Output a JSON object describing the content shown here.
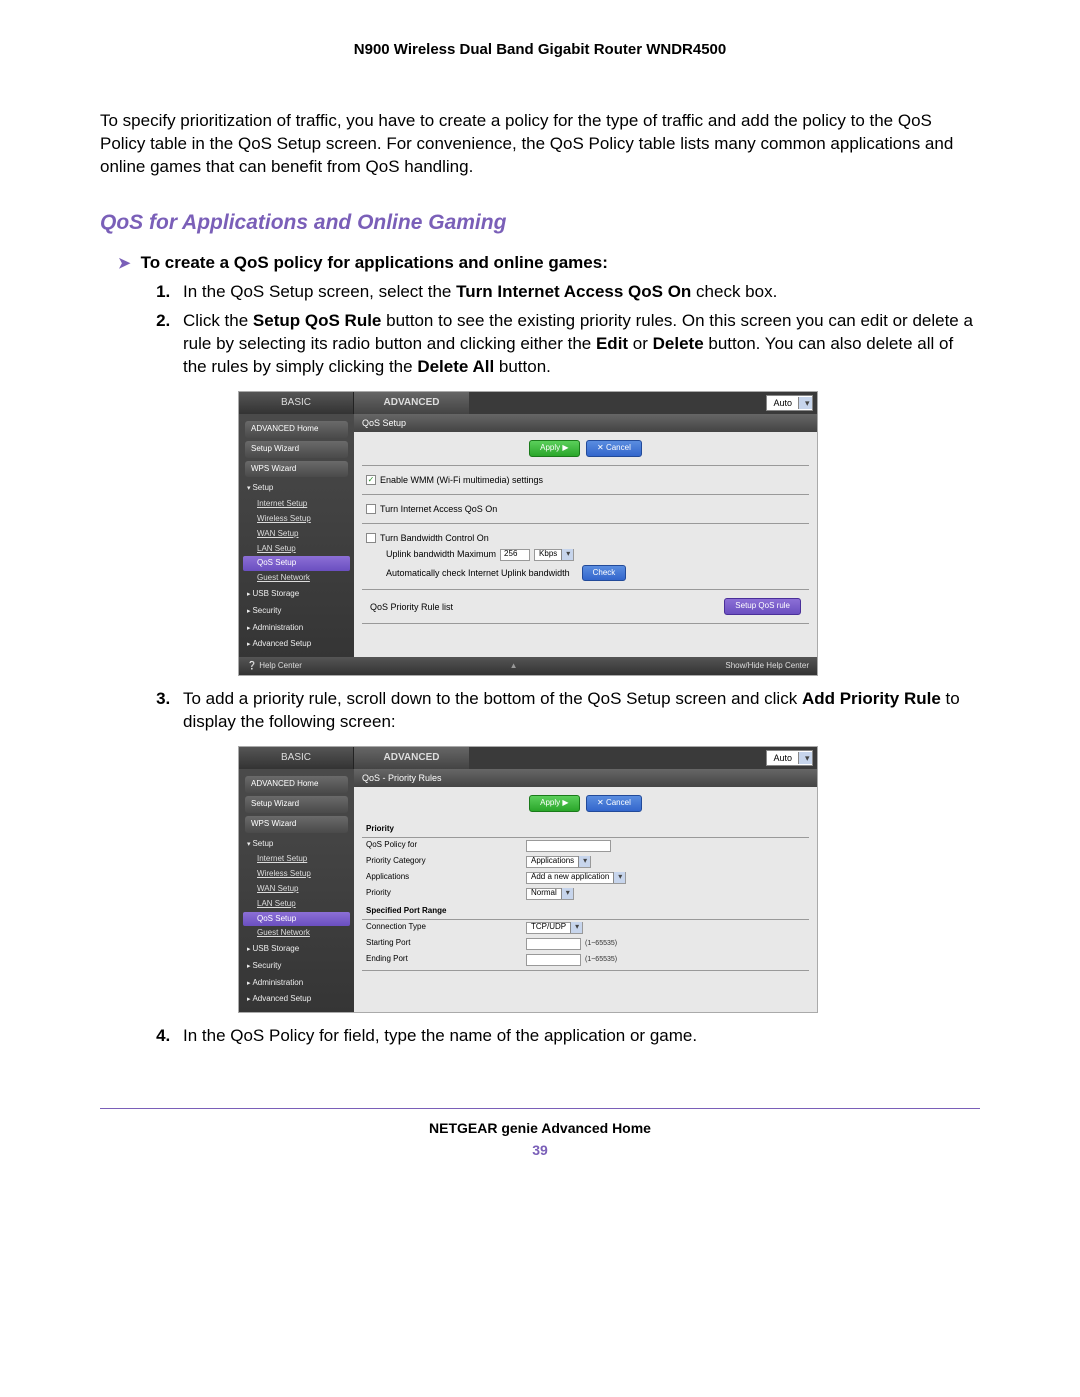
{
  "header": {
    "title": "N900 Wireless Dual Band Gigabit Router WNDR4500"
  },
  "intro": "To specify prioritization of traffic, you have to create a policy for the type of traffic and add the policy to the QoS Policy table in the QoS Setup screen. For convenience, the QoS Policy table lists many common applications and online games that can benefit from QoS handling.",
  "section": {
    "heading": "QoS for Applications and Online Gaming"
  },
  "procedure": {
    "title": "To create a QoS policy for applications and online games:"
  },
  "steps": {
    "s1_pre": "In the QoS Setup screen, select the ",
    "s1_b": "Turn Internet Access QoS On",
    "s1_post": " check box.",
    "s2_a": "Click the ",
    "s2_b1": "Setup QoS Rule",
    "s2_c": " button to see the existing priority rules. On this screen you can edit or delete a rule by selecting its radio button and clicking either the ",
    "s2_b2": "Edit",
    "s2_d": " or ",
    "s2_b3": "Delete",
    "s2_e": " button. You can also delete all of the rules by simply clicking the ",
    "s2_b4": "Delete All",
    "s2_f": " button.",
    "s3_a": "To add a priority rule, scroll down to the bottom of the QoS Setup screen and click ",
    "s3_b": "Add Priority Rule",
    "s3_c": " to display the following screen:",
    "s4": "In the QoS Policy for field, type the name of the application or game."
  },
  "ui": {
    "tabs": {
      "basic": "BASIC",
      "advanced": "ADVANCED",
      "auto": "Auto"
    },
    "sidebar": {
      "advanced_home": "ADVANCED Home",
      "setup_wizard": "Setup Wizard",
      "wps_wizard": "WPS Wizard",
      "setup": "Setup",
      "internet": "Internet Setup",
      "wireless": "Wireless Setup",
      "wan": "WAN Setup",
      "lan": "LAN Setup",
      "qos": "QoS Setup",
      "guest": "Guest Network",
      "usb": "USB Storage",
      "security": "Security",
      "admin": "Administration",
      "adv_setup": "Advanced Setup"
    },
    "buttons": {
      "apply": "Apply ▶",
      "cancel": "✕ Cancel",
      "check": "Check",
      "setup_rule": "Setup QoS rule"
    },
    "shot1": {
      "panel_title": "QoS Setup",
      "wmm": "Enable WMM (Wi-Fi multimedia) settings",
      "qos_on": "Turn Internet Access QoS On",
      "bw_ctrl": "Turn Bandwidth Control On",
      "uplink_label": "Uplink bandwidth Maximum",
      "uplink_value": "256",
      "uplink_unit": "Kbps",
      "autocheck": "Automatically check Internet Uplink bandwidth",
      "rule_list": "QoS Priority Rule list"
    },
    "shot2": {
      "panel_title": "QoS - Priority Rules",
      "priority_hdr": "Priority",
      "policy_for": "QoS Policy for",
      "category": "Priority Category",
      "category_val": "Applications",
      "applications": "Applications",
      "app_val": "Add a new application",
      "priority": "Priority",
      "priority_val": "Normal",
      "port_hdr": "Specified Port Range",
      "conn_type": "Connection Type",
      "conn_val": "TCP/UDP",
      "start_port": "Starting Port",
      "end_port": "Ending Port",
      "range_hint": "(1~65535)"
    },
    "footer": {
      "help": "Help Center",
      "showhide": "Show/Hide Help Center"
    }
  },
  "footer": {
    "line1": "NETGEAR genie Advanced Home",
    "page": "39"
  }
}
